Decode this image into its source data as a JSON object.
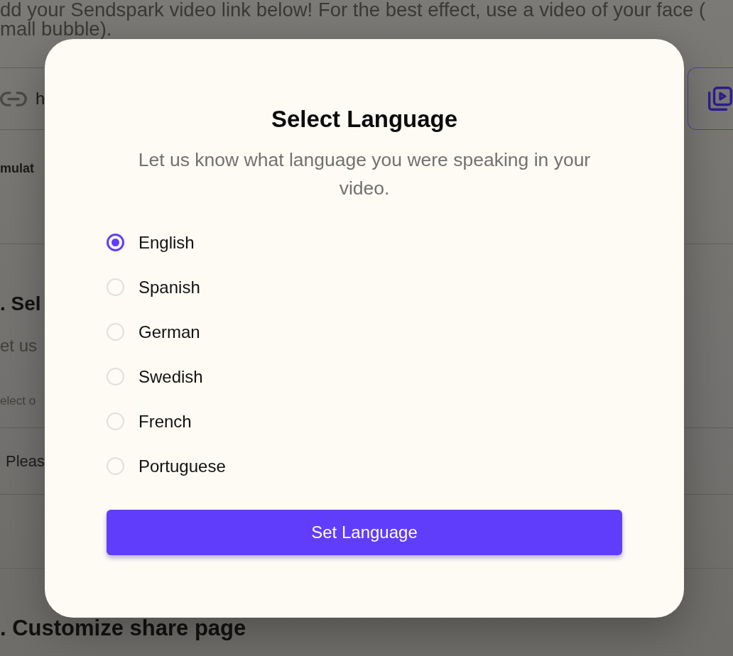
{
  "background_page": {
    "intro_lines": [
      "dd your Sendspark video link below! For the best effect, use a video of your face (",
      "mall bubble)."
    ],
    "video_link_field": {
      "value": "h"
    },
    "option_label": "mulat",
    "section_2": {
      "heading": ". Sel",
      "description": "et us",
      "hint": "elect o",
      "dropdown": {
        "value": "Pleas"
      }
    },
    "section_3": {
      "heading": ". Customize share page"
    }
  },
  "modal": {
    "title": "Select Language",
    "description": "Let us know what language you were speaking in your video.",
    "languages": [
      {
        "label": "English",
        "selected": true
      },
      {
        "label": "Spanish",
        "selected": false
      },
      {
        "label": "German",
        "selected": false
      },
      {
        "label": "Swedish",
        "selected": false
      },
      {
        "label": "French",
        "selected": false
      },
      {
        "label": "Portuguese",
        "selected": false
      }
    ],
    "button": "Set Language"
  }
}
